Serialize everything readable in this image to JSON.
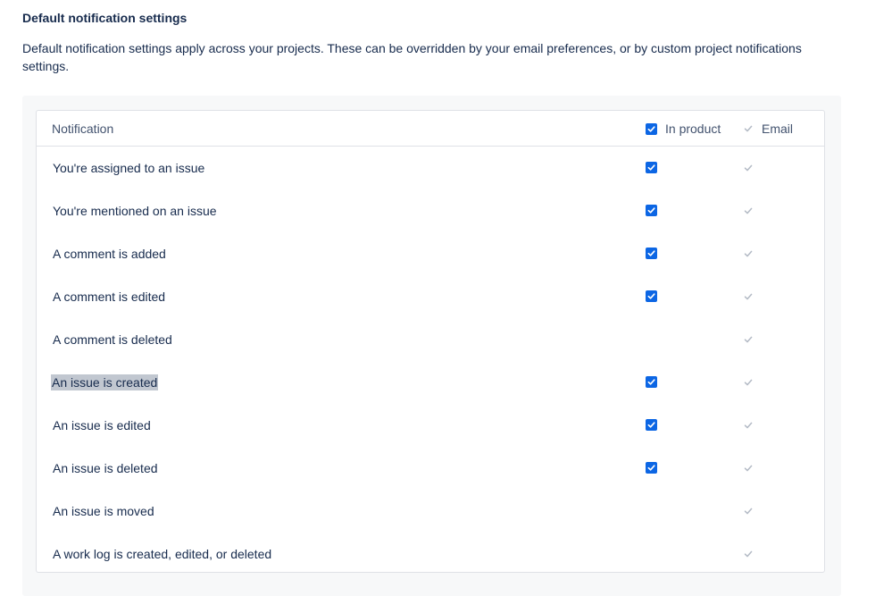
{
  "section": {
    "title": "Default notification settings",
    "description": "Default notification settings apply across your projects. These can be overridden by your email preferences, or by custom project notifications settings."
  },
  "table": {
    "headers": {
      "notification": "Notification",
      "in_product": "In product",
      "email": "Email"
    },
    "rows": [
      {
        "label": "You're assigned to an issue",
        "in_product": true,
        "email": true
      },
      {
        "label": "You're mentioned on an issue",
        "in_product": true,
        "email": true
      },
      {
        "label": "A comment is added",
        "in_product": true,
        "email": true
      },
      {
        "label": "A comment is edited",
        "in_product": true,
        "email": true
      },
      {
        "label": "A comment is deleted",
        "in_product": false,
        "email": true
      },
      {
        "label": "An issue is created",
        "in_product": true,
        "email": true,
        "selected": true
      },
      {
        "label": "An issue is edited",
        "in_product": true,
        "email": true
      },
      {
        "label": "An issue is deleted",
        "in_product": true,
        "email": true
      },
      {
        "label": "An issue is moved",
        "in_product": false,
        "email": true
      },
      {
        "label": "A work log is created, edited, or deleted",
        "in_product": false,
        "email": true
      }
    ]
  },
  "colors": {
    "checkbox_checked": "#0c66e4",
    "email_check_disabled": "#b3bac5",
    "selection_highlight": "#c1c7d0"
  }
}
